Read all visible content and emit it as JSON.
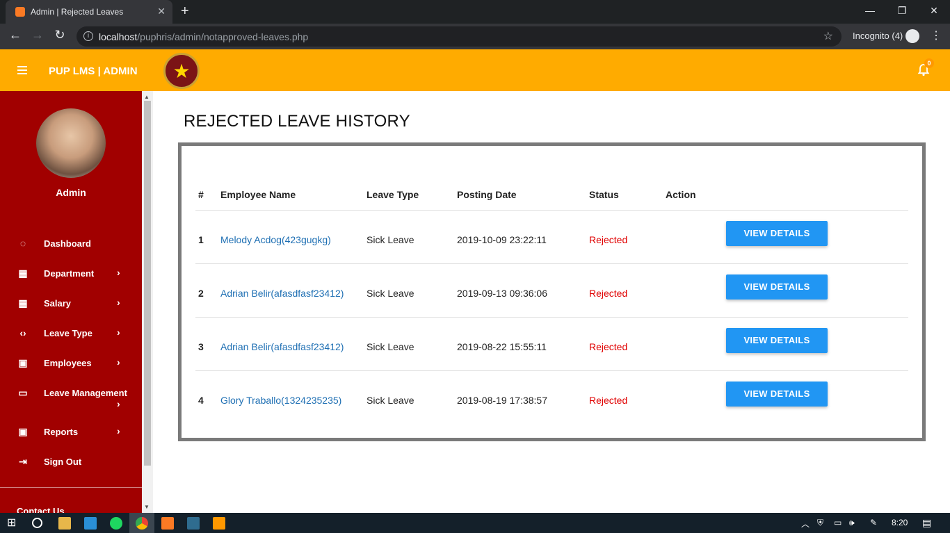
{
  "browser": {
    "tab_title": "Admin | Rejected Leaves",
    "url_host": "localhost",
    "url_path": "/puphris/admin/notapproved-leaves.php",
    "incognito_label": "Incognito (4)"
  },
  "header": {
    "brand": "PUP LMS | ADMIN",
    "notification_count": "0"
  },
  "sidebar": {
    "user_name": "Admin",
    "items": [
      {
        "label": "Dashboard",
        "icon": "dashboard-icon"
      },
      {
        "label": "Department",
        "icon": "grid-icon"
      },
      {
        "label": "Salary",
        "icon": "grid-icon"
      },
      {
        "label": "Leave Type",
        "icon": "code-icon"
      },
      {
        "label": "Employees",
        "icon": "account-box-icon"
      },
      {
        "label": "Leave Management",
        "icon": "monitor-icon"
      },
      {
        "label": "Reports",
        "icon": "account-box-icon"
      },
      {
        "label": "Sign Out",
        "icon": "exit-icon"
      }
    ],
    "contact": "Contact Us"
  },
  "main": {
    "title": "REJECTED LEAVE HISTORY",
    "columns": [
      "#",
      "Employee Name",
      "Leave Type",
      "Posting Date",
      "Status",
      "Action"
    ],
    "rows": [
      {
        "num": "1",
        "name": "Melody Acdog(423gugkg)",
        "type": "Sick Leave",
        "date": "2019-10-09 23:22:11",
        "status": "Rejected",
        "action": "VIEW DETAILS"
      },
      {
        "num": "2",
        "name": "Adrian Belir(afasdfasf23412)",
        "type": "Sick Leave",
        "date": "2019-09-13 09:36:06",
        "status": "Rejected",
        "action": "VIEW DETAILS"
      },
      {
        "num": "3",
        "name": "Adrian Belir(afasdfasf23412)",
        "type": "Sick Leave",
        "date": "2019-08-22 15:55:11",
        "status": "Rejected",
        "action": "VIEW DETAILS"
      },
      {
        "num": "4",
        "name": "Glory Traballo(1324235235)",
        "type": "Sick Leave",
        "date": "2019-08-19 17:38:57",
        "status": "Rejected",
        "action": "VIEW DETAILS"
      }
    ]
  },
  "taskbar": {
    "time": "8:20"
  },
  "colors": {
    "header": "#ffab00",
    "sidebar": "#a10000",
    "button": "#2196f3",
    "rejected": "#e00000",
    "link": "#1e6fb3"
  }
}
